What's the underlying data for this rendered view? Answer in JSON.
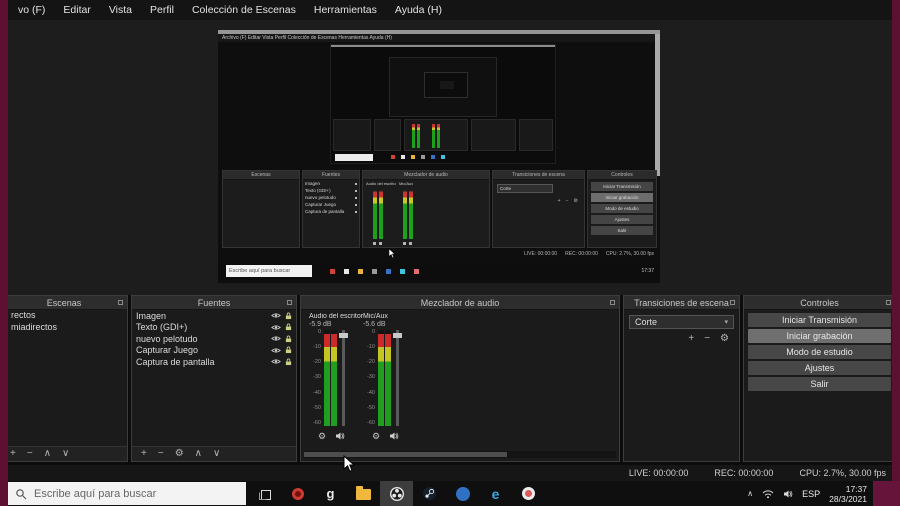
{
  "colors": {
    "edge": "#5d1132",
    "meter_green": "#1f9e1f",
    "meter_yellow": "#c4c422",
    "meter_red": "#cc2a2a",
    "active_button": "#6f6f6f",
    "taskbar_active": "#3d3d3d"
  },
  "menu": {
    "items": [
      "vo (F)",
      "Editar",
      "Vista",
      "Perfil",
      "Colección de Escenas",
      "Herramientas",
      "Ayuda (H)"
    ],
    "mini_text": "Archivo (F)   Editar   Vista   Perfil   Colección de Escenas   Herramientas   Ayuda (H)"
  },
  "icons": {
    "add": "+",
    "remove": "−",
    "gear": "⚙",
    "up": "∧",
    "down": "∨",
    "dropdown_arrow": "▾",
    "tray_chevron": "∧"
  },
  "scenes_panel": {
    "title": "Escenas",
    "items": [
      "rectos",
      "miadirectos"
    ]
  },
  "sources_panel": {
    "title": "Fuentes",
    "items": [
      "Imagen",
      "Texto (GDI+)",
      "nuevo pelotudo",
      "Capturar Juego",
      "Captura de pantalla"
    ]
  },
  "mixer_panel": {
    "title": "Mezclador de audio",
    "meters": [
      {
        "name": "Audio del escritorio",
        "db": "-5.9 dB"
      },
      {
        "name": "Mic/Aux",
        "db": "-5.6 dB"
      }
    ],
    "scale": [
      "0",
      "-10",
      "-20",
      "-30",
      "-40",
      "-50",
      "-60"
    ]
  },
  "transitions_panel": {
    "title": "Transiciones de escena",
    "selected": "Corte"
  },
  "controls_panel": {
    "title": "Controles",
    "buttons": [
      "Iniciar Transmisión",
      "Iniciar grabación",
      "Modo de estudio",
      "Ajustes",
      "Salir"
    ],
    "active": "Iniciar grabación"
  },
  "status_bar": {
    "live": "LIVE: 00:00:00",
    "rec": "REC: 00:00:00",
    "cpu": "CPU: 2.7%, 30.00 fps"
  },
  "taskbar": {
    "search_placeholder": "Escribe aquí para buscar",
    "gimp_glyph": "g",
    "edge_glyph": "e",
    "language": "ESP",
    "time": "17:37",
    "date": "28/3/2021"
  }
}
